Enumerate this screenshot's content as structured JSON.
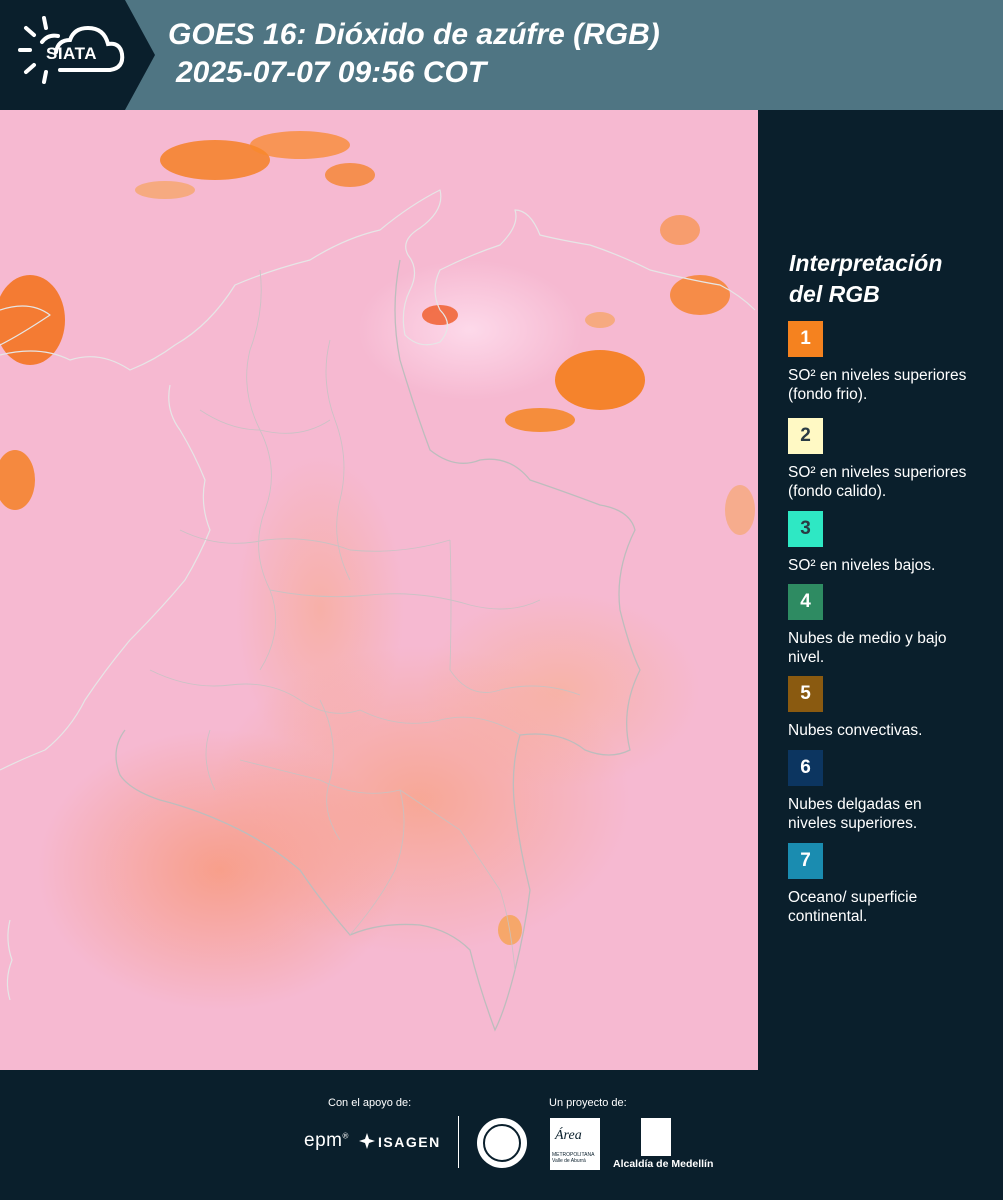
{
  "header": {
    "logo_text": "SIATA",
    "title_line1": "GOES 16: Dióxido de azúfre (RGB)",
    "title_line2": "2025-07-07 09:56 COT"
  },
  "legend": {
    "title_line1": "Interpretación",
    "title_line2": "del RGB",
    "items": [
      {
        "number": "1",
        "label": "SO² en niveles superiores (fondo frio).",
        "color": "#f5821f"
      },
      {
        "number": "2",
        "label": "SO² en niveles superiores (fondo calido).",
        "color": "#fff9c4"
      },
      {
        "number": "3",
        "label": "SO² en niveles bajos.",
        "color": "#2ee8c4"
      },
      {
        "number": "4",
        "label": "Nubes de medio y bajo nivel.",
        "color": "#2e8b62"
      },
      {
        "number": "5",
        "label": "Nubes convectivas.",
        "color": "#8a5a10"
      },
      {
        "number": "6",
        "label": "Nubes delgadas en niveles superiores.",
        "color": "#0c3560"
      },
      {
        "number": "7",
        "label": "Oceano/ superficie continental.",
        "color": "#1a8cb0"
      }
    ]
  },
  "footer": {
    "support_label": "Con el apoyo de:",
    "project_label": "Un proyecto de:",
    "epm": "epm",
    "epm_mark": "®",
    "isagen": "ISAGEN",
    "area_logo": "Área",
    "area_sub": "METROPOLITANA Valle de Aburrá",
    "alcaldia": "Alcaldía de Medellín"
  },
  "colors": {
    "map_background": "#f6b9d1",
    "panel": "#0a1f2c",
    "header": "#4f7583",
    "cloud_orange": "#f57d1a",
    "border_lines": "#c8c8c8"
  }
}
